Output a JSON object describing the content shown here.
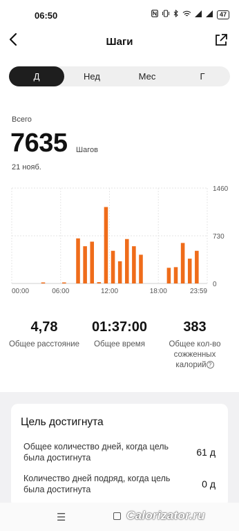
{
  "status_bar": {
    "time": "06:50",
    "icons": [
      "nfc-icon",
      "vibrate-icon",
      "bluetooth-icon",
      "wifi-icon",
      "signal-icon",
      "signal-icon"
    ],
    "battery": "47"
  },
  "header": {
    "title": "Шаги",
    "back_icon": "back-arrow-icon",
    "share_icon": "share-icon"
  },
  "tabs": [
    {
      "label": "Д",
      "active": true
    },
    {
      "label": "Нед",
      "active": false
    },
    {
      "label": "Мес",
      "active": false
    },
    {
      "label": "Г",
      "active": false
    }
  ],
  "summary": {
    "label": "Всего",
    "value": "7635",
    "unit": "Шагов",
    "date": "21 нояб."
  },
  "chart_data": {
    "type": "bar",
    "color": "#ef6c1a",
    "x_ticks": [
      "00:00",
      "06:00",
      "12:00",
      "18:00",
      "23:59"
    ],
    "y_ticks": [
      "1460",
      "730",
      "0"
    ],
    "ylim": [
      0,
      1460
    ],
    "bins_per_hour": 2,
    "values": [
      0,
      0,
      0,
      0,
      10,
      0,
      0,
      10,
      0,
      690,
      570,
      640,
      20,
      1170,
      500,
      340,
      680,
      570,
      440,
      0,
      0,
      0,
      240,
      250,
      620,
      380,
      500,
      0
    ]
  },
  "stats": [
    {
      "value": "4,78",
      "label": "Общее расстояние"
    },
    {
      "value": "01:37:00",
      "label": "Общее время"
    },
    {
      "value": "383",
      "label_line1": "Общее кол-во",
      "label_line2": "сожженных",
      "label_line3": "калорий"
    }
  ],
  "goal": {
    "title": "Цель достигнута",
    "rows": [
      {
        "label": "Общее количество дней, когда цель была достигнута",
        "value": "61 д"
      },
      {
        "label": "Количество дней подряд, когда цель была достигнута",
        "value": "0 д"
      }
    ]
  },
  "navbar": {
    "watermark": "Calorizator.ru"
  }
}
